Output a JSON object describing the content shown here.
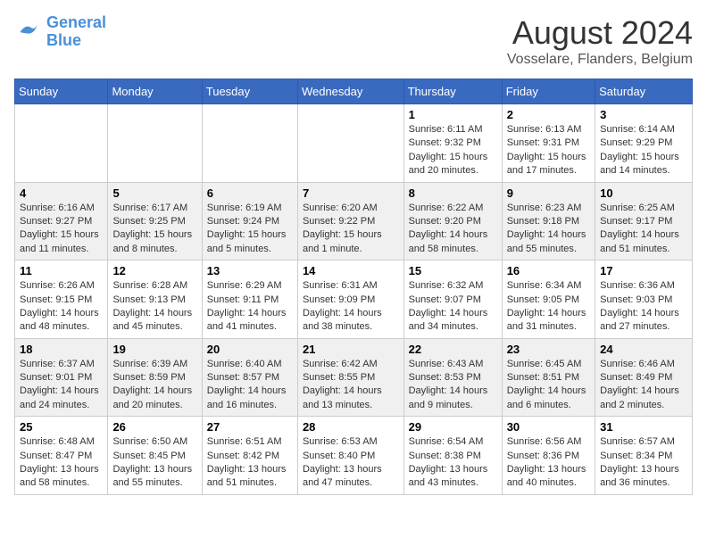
{
  "header": {
    "logo_line1": "General",
    "logo_line2": "Blue",
    "title": "August 2024",
    "subtitle": "Vosselare, Flanders, Belgium"
  },
  "weekdays": [
    "Sunday",
    "Monday",
    "Tuesday",
    "Wednesday",
    "Thursday",
    "Friday",
    "Saturday"
  ],
  "weeks": [
    [
      {
        "day": "",
        "info": ""
      },
      {
        "day": "",
        "info": ""
      },
      {
        "day": "",
        "info": ""
      },
      {
        "day": "",
        "info": ""
      },
      {
        "day": "1",
        "info": "Sunrise: 6:11 AM\nSunset: 9:32 PM\nDaylight: 15 hours and 20 minutes."
      },
      {
        "day": "2",
        "info": "Sunrise: 6:13 AM\nSunset: 9:31 PM\nDaylight: 15 hours and 17 minutes."
      },
      {
        "day": "3",
        "info": "Sunrise: 6:14 AM\nSunset: 9:29 PM\nDaylight: 15 hours and 14 minutes."
      }
    ],
    [
      {
        "day": "4",
        "info": "Sunrise: 6:16 AM\nSunset: 9:27 PM\nDaylight: 15 hours and 11 minutes."
      },
      {
        "day": "5",
        "info": "Sunrise: 6:17 AM\nSunset: 9:25 PM\nDaylight: 15 hours and 8 minutes."
      },
      {
        "day": "6",
        "info": "Sunrise: 6:19 AM\nSunset: 9:24 PM\nDaylight: 15 hours and 5 minutes."
      },
      {
        "day": "7",
        "info": "Sunrise: 6:20 AM\nSunset: 9:22 PM\nDaylight: 15 hours and 1 minute."
      },
      {
        "day": "8",
        "info": "Sunrise: 6:22 AM\nSunset: 9:20 PM\nDaylight: 14 hours and 58 minutes."
      },
      {
        "day": "9",
        "info": "Sunrise: 6:23 AM\nSunset: 9:18 PM\nDaylight: 14 hours and 55 minutes."
      },
      {
        "day": "10",
        "info": "Sunrise: 6:25 AM\nSunset: 9:17 PM\nDaylight: 14 hours and 51 minutes."
      }
    ],
    [
      {
        "day": "11",
        "info": "Sunrise: 6:26 AM\nSunset: 9:15 PM\nDaylight: 14 hours and 48 minutes."
      },
      {
        "day": "12",
        "info": "Sunrise: 6:28 AM\nSunset: 9:13 PM\nDaylight: 14 hours and 45 minutes."
      },
      {
        "day": "13",
        "info": "Sunrise: 6:29 AM\nSunset: 9:11 PM\nDaylight: 14 hours and 41 minutes."
      },
      {
        "day": "14",
        "info": "Sunrise: 6:31 AM\nSunset: 9:09 PM\nDaylight: 14 hours and 38 minutes."
      },
      {
        "day": "15",
        "info": "Sunrise: 6:32 AM\nSunset: 9:07 PM\nDaylight: 14 hours and 34 minutes."
      },
      {
        "day": "16",
        "info": "Sunrise: 6:34 AM\nSunset: 9:05 PM\nDaylight: 14 hours and 31 minutes."
      },
      {
        "day": "17",
        "info": "Sunrise: 6:36 AM\nSunset: 9:03 PM\nDaylight: 14 hours and 27 minutes."
      }
    ],
    [
      {
        "day": "18",
        "info": "Sunrise: 6:37 AM\nSunset: 9:01 PM\nDaylight: 14 hours and 24 minutes."
      },
      {
        "day": "19",
        "info": "Sunrise: 6:39 AM\nSunset: 8:59 PM\nDaylight: 14 hours and 20 minutes."
      },
      {
        "day": "20",
        "info": "Sunrise: 6:40 AM\nSunset: 8:57 PM\nDaylight: 14 hours and 16 minutes."
      },
      {
        "day": "21",
        "info": "Sunrise: 6:42 AM\nSunset: 8:55 PM\nDaylight: 14 hours and 13 minutes."
      },
      {
        "day": "22",
        "info": "Sunrise: 6:43 AM\nSunset: 8:53 PM\nDaylight: 14 hours and 9 minutes."
      },
      {
        "day": "23",
        "info": "Sunrise: 6:45 AM\nSunset: 8:51 PM\nDaylight: 14 hours and 6 minutes."
      },
      {
        "day": "24",
        "info": "Sunrise: 6:46 AM\nSunset: 8:49 PM\nDaylight: 14 hours and 2 minutes."
      }
    ],
    [
      {
        "day": "25",
        "info": "Sunrise: 6:48 AM\nSunset: 8:47 PM\nDaylight: 13 hours and 58 minutes."
      },
      {
        "day": "26",
        "info": "Sunrise: 6:50 AM\nSunset: 8:45 PM\nDaylight: 13 hours and 55 minutes."
      },
      {
        "day": "27",
        "info": "Sunrise: 6:51 AM\nSunset: 8:42 PM\nDaylight: 13 hours and 51 minutes."
      },
      {
        "day": "28",
        "info": "Sunrise: 6:53 AM\nSunset: 8:40 PM\nDaylight: 13 hours and 47 minutes."
      },
      {
        "day": "29",
        "info": "Sunrise: 6:54 AM\nSunset: 8:38 PM\nDaylight: 13 hours and 43 minutes."
      },
      {
        "day": "30",
        "info": "Sunrise: 6:56 AM\nSunset: 8:36 PM\nDaylight: 13 hours and 40 minutes."
      },
      {
        "day": "31",
        "info": "Sunrise: 6:57 AM\nSunset: 8:34 PM\nDaylight: 13 hours and 36 minutes."
      }
    ]
  ]
}
